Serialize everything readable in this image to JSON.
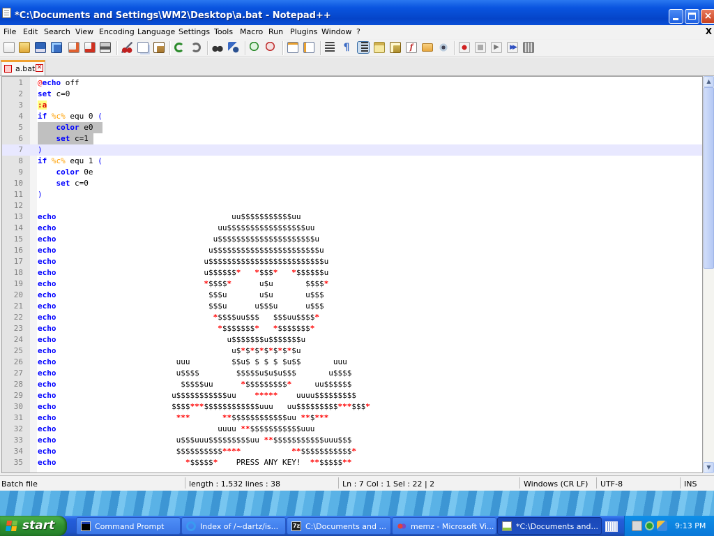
{
  "window": {
    "title": "*C:\\Documents and Settings\\WM2\\Desktop\\a.bat - Notepad++",
    "controls": {
      "minimize": "minimize",
      "maximize": "maximize",
      "close": "×"
    }
  },
  "menubar": {
    "items": [
      "File",
      "Edit",
      "Search",
      "View",
      "Encoding",
      "Language",
      "Settings",
      "Tools",
      "Macro",
      "Run",
      "Plugins",
      "Window",
      "?"
    ],
    "close_glyph": "X"
  },
  "toolbar": {
    "icons": [
      "new-file-icon",
      "open-file-icon",
      "save-icon",
      "save-all-icon",
      "close-icon",
      "close-all-icon",
      "print-icon",
      "cut-icon",
      "copy-icon",
      "paste-icon",
      "undo-icon",
      "redo-icon",
      "find-icon",
      "replace-icon",
      "zoom-in-icon",
      "zoom-out-icon",
      "sync-vertical-icon",
      "sync-horizontal-icon",
      "word-wrap-icon",
      "show-all-chars-icon",
      "indent-guide-icon",
      "user-defined-language-icon",
      "doc-map-icon",
      "function-list-icon",
      "folder-as-workspace-icon",
      "monitor-icon",
      "record-macro-icon",
      "stop-macro-icon",
      "play-macro-icon",
      "run-macro-multiple-icon",
      "save-macro-icon"
    ]
  },
  "tabs": [
    {
      "label": "a.bat",
      "close": "✕"
    }
  ],
  "editor": {
    "lines": [
      {
        "n": "1"
      },
      {
        "n": "2"
      },
      {
        "n": "3"
      },
      {
        "n": "4"
      },
      {
        "n": "5"
      },
      {
        "n": "6"
      },
      {
        "n": "7"
      },
      {
        "n": "8"
      },
      {
        "n": "9"
      },
      {
        "n": "10"
      },
      {
        "n": "11"
      },
      {
        "n": "12"
      },
      {
        "n": "13"
      },
      {
        "n": "14"
      },
      {
        "n": "15"
      },
      {
        "n": "16"
      },
      {
        "n": "17"
      },
      {
        "n": "18"
      },
      {
        "n": "19"
      },
      {
        "n": "20"
      },
      {
        "n": "21"
      },
      {
        "n": "22"
      },
      {
        "n": "23"
      },
      {
        "n": "24"
      },
      {
        "n": "25"
      },
      {
        "n": "26"
      },
      {
        "n": "27"
      },
      {
        "n": "28"
      },
      {
        "n": "29"
      },
      {
        "n": "30"
      },
      {
        "n": "31"
      },
      {
        "n": "32"
      },
      {
        "n": "33"
      },
      {
        "n": "34"
      },
      {
        "n": "35"
      }
    ],
    "code": {
      "l1": {
        "a": "@",
        "b": "echo",
        "c": " off"
      },
      "l2": {
        "a": "set",
        "b": " c=0"
      },
      "l3": {
        "a": ":a"
      },
      "l4": {
        "a": "if",
        "b": " ",
        "c": "%c%",
        "d": " equ 0 ",
        "e": "("
      },
      "l5": {
        "a": "    ",
        "b": "color",
        "c": " e0  "
      },
      "l6": {
        "a": "    ",
        "b": "set",
        "c": " c=1 "
      },
      "l7": {
        "a": ")"
      },
      "l8": {
        "a": "if",
        "b": " ",
        "c": "%c%",
        "d": " equ 1 ",
        "e": "("
      },
      "l9": {
        "a": "    ",
        "b": "color",
        "c": " 0e"
      },
      "l10": {
        "a": "    ",
        "b": "set",
        "c": " c=0"
      },
      "l11": {
        "a": ")"
      },
      "echo": "echo",
      "art": {
        "13": [
          "                                      uu$$$$$$$$$$$uu"
        ],
        "14": [
          "                                   uu$$$$$$$$$$$$$$$$$uu"
        ],
        "15": [
          "                                  u$$$$$$$$$$$$$$$$$$$$$u"
        ],
        "16": [
          "                                 u$$$$$$$$$$$$$$$$$$$$$$$u"
        ],
        "17": [
          "                                u$$$$$$$$$$$$$$$$$$$$$$$$$u"
        ],
        "18": [
          "                                u$$$$$$",
          "*",
          "   ",
          "*",
          "$$$",
          "*",
          "   ",
          "*",
          "$$$$$$u"
        ],
        "19": [
          "                                ",
          "*",
          "$$$$",
          "*",
          "      u$u       $$$$",
          "*"
        ],
        "20": [
          "                                 $$$u       u$u       u$$$"
        ],
        "21": [
          "                                 $$$u      u$$$u      u$$$"
        ],
        "22": [
          "                                  ",
          "*",
          "$$$$uu$$$   $$$uu$$$$",
          "*"
        ],
        "23": [
          "                                   ",
          "*",
          "$$$$$$$",
          "*",
          "   ",
          "*",
          "$$$$$$$",
          "*"
        ],
        "24": [
          "                                     u$$$$$$$u$$$$$$$u"
        ],
        "25": [
          "                                      u$",
          "*",
          "$",
          "*",
          "$",
          "*",
          "$",
          "*",
          "$",
          "*",
          "$",
          "*",
          "$u"
        ],
        "26": [
          "                          uuu         $$u$ $ $ $ $u$$       uuu"
        ],
        "27": [
          "                          u$$$$        $$$$$u$u$u$$$       u$$$$"
        ],
        "28": [
          "                           $$$$$uu      ",
          "*",
          "$$$$$$$$$",
          "*",
          "     uu$$$$$$"
        ],
        "29": [
          "                         u$$$$$$$$$$$uu    ",
          "*****",
          "    uuuu$$$$$$$$$"
        ],
        "30": [
          "                         $$$$",
          "***",
          "$$$$$$$$$$$$uuu   uu$$$$$$$$$",
          "***",
          "$$$",
          "*"
        ],
        "31": [
          "                          ",
          "***",
          "       ",
          "**",
          "$$$$$$$$$$$$uu ",
          "**",
          "$",
          "***"
        ],
        "32": [
          "                                   uuuu ",
          "**",
          "$$$$$$$$$$$uuu"
        ],
        "33": [
          "                          u$$$uuu$$$$$$$$$uu ",
          "**",
          "$$$$$$$$$$$uuu$$$"
        ],
        "34": [
          "                          $$$$$$$$$$",
          "****",
          "           ",
          "**",
          "$$$$$$$$$$$",
          "*"
        ],
        "35": [
          "                            ",
          "*",
          "$$$$$",
          "*",
          "    PRESS ANY KEY!  ",
          "**",
          "$$$$$",
          "**"
        ]
      }
    }
  },
  "scrollbar": {
    "up": "▲",
    "down": "▼"
  },
  "statusbar": {
    "filetype": "Batch file",
    "length_lines": "length : 1,532    lines : 38",
    "position": "Ln : 7    Col : 1    Sel : 22 | 2",
    "eol": "Windows (CR LF)",
    "encoding": "UTF-8",
    "mode": "INS"
  },
  "taskbar": {
    "start_label": "start",
    "items": [
      {
        "label": "Command Prompt",
        "icon": "command-prompt-icon"
      },
      {
        "label": "Index of /~dartz/is...",
        "icon": "internet-explorer-icon"
      },
      {
        "label": "C:\\Documents and ...",
        "icon": "7zip-icon"
      },
      {
        "label": "memz - Microsoft Vi...",
        "icon": "visual-studio-icon"
      },
      {
        "label": "*C:\\Documents and...",
        "icon": "notepad-plus-plus-icon"
      }
    ],
    "clock": "9:13 PM"
  },
  "colors": {
    "keyword": "#0000ff",
    "variable": "#ffa000",
    "label": "#e00000",
    "title_bar": "#0a55e0",
    "taskbar": "#245edb",
    "start_button": "#2f8f2f"
  }
}
